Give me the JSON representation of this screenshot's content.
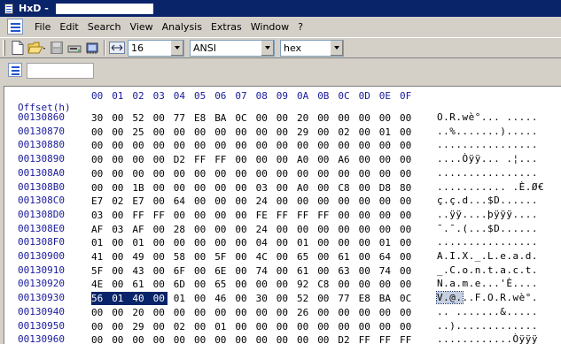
{
  "window": {
    "title_prefix": "HxD - "
  },
  "menu": [
    "File",
    "Edit",
    "Search",
    "View",
    "Analysis",
    "Extras",
    "Window",
    "?"
  ],
  "toolbar": {
    "bytes_per_row": "16",
    "charset": "ANSI",
    "offset_base": "hex"
  },
  "editor": {
    "offset_header": "Offset(h)",
    "column_headers": [
      "00",
      "01",
      "02",
      "03",
      "04",
      "05",
      "06",
      "07",
      "08",
      "09",
      "0A",
      "0B",
      "0C",
      "0D",
      "0E",
      "0F"
    ],
    "rows": [
      {
        "offset": "00130860",
        "bytes": [
          "30",
          "00",
          "52",
          "00",
          "77",
          "E8",
          "BA",
          "0C",
          "00",
          "00",
          "20",
          "00",
          "00",
          "00",
          "00",
          "00"
        ],
        "text": "O.R.wè°... ....."
      },
      {
        "offset": "00130870",
        "bytes": [
          "00",
          "00",
          "25",
          "00",
          "00",
          "00",
          "00",
          "00",
          "00",
          "00",
          "29",
          "00",
          "02",
          "00",
          "01",
          "00"
        ],
        "text": "..%.......)....."
      },
      {
        "offset": "00130880",
        "bytes": [
          "00",
          "00",
          "00",
          "00",
          "00",
          "00",
          "00",
          "00",
          "00",
          "00",
          "00",
          "00",
          "00",
          "00",
          "00",
          "00"
        ],
        "text": "................"
      },
      {
        "offset": "00130890",
        "bytes": [
          "00",
          "00",
          "00",
          "00",
          "D2",
          "FF",
          "FF",
          "00",
          "00",
          "00",
          "A0",
          "00",
          "A6",
          "00",
          "00",
          "00"
        ],
        "text": "....Òÿÿ... .¦..."
      },
      {
        "offset": "001308A0",
        "bytes": [
          "00",
          "00",
          "00",
          "00",
          "00",
          "00",
          "00",
          "00",
          "00",
          "00",
          "00",
          "00",
          "00",
          "00",
          "00",
          "00"
        ],
        "text": "................"
      },
      {
        "offset": "001308B0",
        "bytes": [
          "00",
          "00",
          "1B",
          "00",
          "00",
          "00",
          "00",
          "00",
          "03",
          "00",
          "A0",
          "00",
          "C8",
          "00",
          "D8",
          "80"
        ],
        "text": "........... .È.Ø€"
      },
      {
        "offset": "001308C0",
        "bytes": [
          "E7",
          "02",
          "E7",
          "00",
          "64",
          "00",
          "00",
          "00",
          "24",
          "00",
          "00",
          "00",
          "00",
          "00",
          "00",
          "00"
        ],
        "text": "ç.ç.d...$D......"
      },
      {
        "offset": "001308D0",
        "bytes": [
          "03",
          "00",
          "FF",
          "FF",
          "00",
          "00",
          "00",
          "00",
          "FE",
          "FF",
          "FF",
          "FF",
          "00",
          "00",
          "00",
          "00"
        ],
        "text": "..ÿÿ....þÿÿÿ...."
      },
      {
        "offset": "001308E0",
        "bytes": [
          "AF",
          "03",
          "AF",
          "00",
          "28",
          "00",
          "00",
          "00",
          "24",
          "00",
          "00",
          "00",
          "00",
          "00",
          "00",
          "00"
        ],
        "text": "¯.¯.(...$D......"
      },
      {
        "offset": "001308F0",
        "bytes": [
          "01",
          "00",
          "01",
          "00",
          "00",
          "00",
          "00",
          "00",
          "04",
          "00",
          "01",
          "00",
          "00",
          "00",
          "01",
          "00"
        ],
        "text": "................"
      },
      {
        "offset": "00130900",
        "bytes": [
          "41",
          "00",
          "49",
          "00",
          "58",
          "00",
          "5F",
          "00",
          "4C",
          "00",
          "65",
          "00",
          "61",
          "00",
          "64",
          "00"
        ],
        "text": "A.I.X._.L.e.a.d."
      },
      {
        "offset": "00130910",
        "bytes": [
          "5F",
          "00",
          "43",
          "00",
          "6F",
          "00",
          "6E",
          "00",
          "74",
          "00",
          "61",
          "00",
          "63",
          "00",
          "74",
          "00"
        ],
        "text": "_.C.o.n.t.a.c.t."
      },
      {
        "offset": "00130920",
        "bytes": [
          "4E",
          "00",
          "61",
          "00",
          "6D",
          "00",
          "65",
          "00",
          "00",
          "00",
          "92",
          "C8",
          "00",
          "00",
          "00",
          "00"
        ],
        "text": "N.a.m.e...'È...."
      },
      {
        "offset": "00130930",
        "bytes": [
          "56",
          "01",
          "40",
          "00",
          "01",
          "00",
          "46",
          "00",
          "30",
          "00",
          "52",
          "00",
          "77",
          "E8",
          "BA",
          "0C"
        ],
        "text": "V.@...F.O.R.wè°."
      },
      {
        "offset": "00130940",
        "bytes": [
          "00",
          "00",
          "20",
          "00",
          "00",
          "00",
          "00",
          "00",
          "00",
          "00",
          "26",
          "00",
          "00",
          "00",
          "00",
          "00"
        ],
        "text": ".. .......&....."
      },
      {
        "offset": "00130950",
        "bytes": [
          "00",
          "00",
          "29",
          "00",
          "02",
          "00",
          "01",
          "00",
          "00",
          "00",
          "00",
          "00",
          "00",
          "00",
          "00",
          "00"
        ],
        "text": "..)............."
      },
      {
        "offset": "00130960",
        "bytes": [
          "00",
          "00",
          "00",
          "00",
          "00",
          "00",
          "00",
          "00",
          "00",
          "00",
          "00",
          "00",
          "D2",
          "FF",
          "FF",
          "FF"
        ],
        "text": "............Òÿÿÿ"
      }
    ],
    "selection": {
      "row": 13,
      "start": 0,
      "end": 3,
      "ascii_selected": "V.@."
    }
  }
}
